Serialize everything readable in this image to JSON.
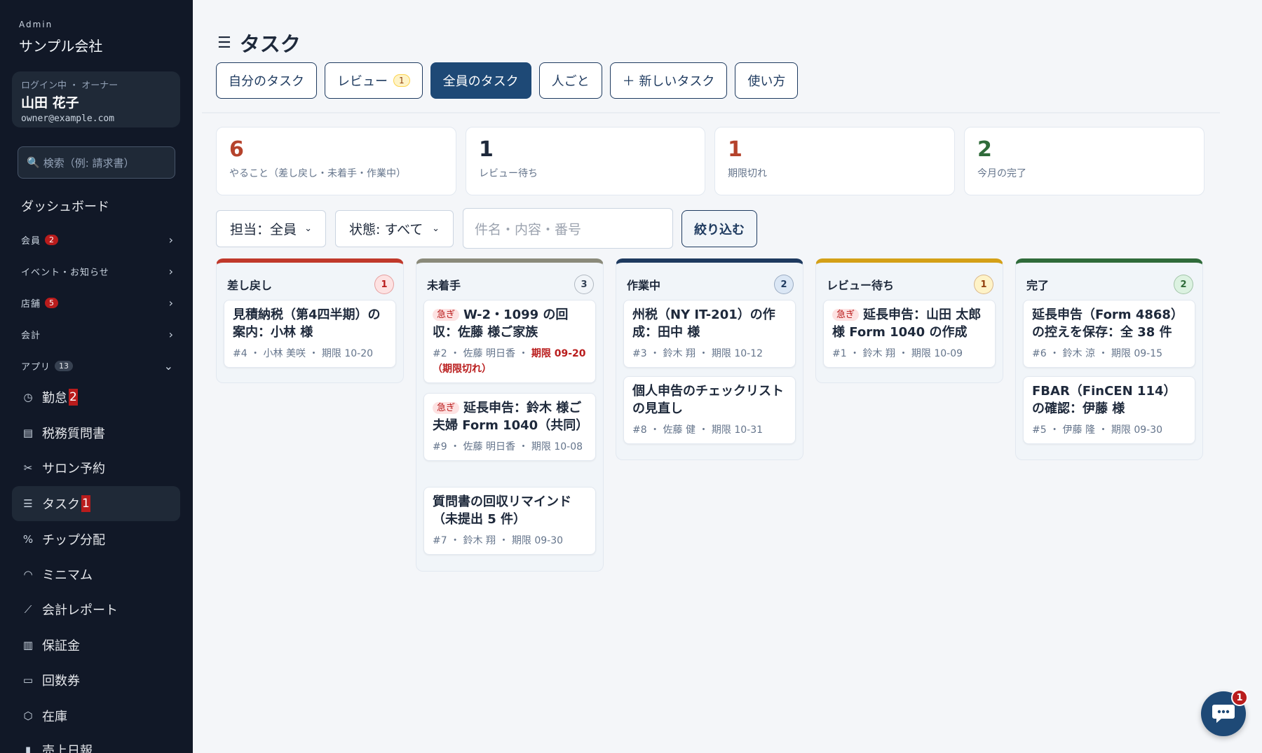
{
  "sidebar": {
    "brand_small": "Admin",
    "brand_name": "サンプル会社",
    "user": {
      "role": "ログイン中 ・ オーナー",
      "name": "山田 花子",
      "email": "owner@example.com"
    },
    "search_placeholder": "検索（例: 請求書）",
    "dashboard": "ダッシュボード",
    "groups": [
      {
        "label": "会員",
        "count": "2"
      },
      {
        "label": "イベント・お知らせ"
      },
      {
        "label": "店舗",
        "count": "5"
      },
      {
        "label": "会計"
      },
      {
        "label": "アプリ",
        "count": "13"
      }
    ],
    "items": [
      {
        "label": "勤怠",
        "badge": "2",
        "icon": "clock-icon"
      },
      {
        "label": "税務質問書",
        "icon": "document-icon"
      },
      {
        "label": "サロン予約",
        "icon": "scissors-icon"
      },
      {
        "label": "タスク",
        "badge": "1",
        "icon": "checklist-icon"
      },
      {
        "label": "チップ分配",
        "icon": "percent-icon"
      },
      {
        "label": "ミニマム",
        "icon": "gauge-icon"
      },
      {
        "label": "会計レポート",
        "icon": "chart-icon"
      },
      {
        "label": "保証金",
        "icon": "receipt-icon"
      },
      {
        "label": "回数券",
        "icon": "ticket-icon"
      },
      {
        "label": "在庫",
        "icon": "box-icon"
      },
      {
        "label": "売上日報",
        "icon": "bar-chart-icon"
      }
    ]
  },
  "page": {
    "title": "タスク"
  },
  "tabs": [
    {
      "label": "自分のタスク"
    },
    {
      "label": "レビュー",
      "pill": "1"
    },
    {
      "label": "全員のタスク"
    },
    {
      "label": "人ごと"
    },
    {
      "label": "＋ 新しいタスク"
    },
    {
      "label": "使い方"
    }
  ],
  "stats": [
    {
      "value": "6",
      "label": "やること（差し戻し・未着手・作業中）",
      "color": "#b5432c"
    },
    {
      "value": "1",
      "label": "レビュー待ち",
      "color": "#1e293b"
    },
    {
      "value": "1",
      "label": "期限切れ",
      "color": "#b5432c"
    },
    {
      "value": "2",
      "label": "今月の完了",
      "color": "#2f6b3a"
    }
  ],
  "filters": {
    "assignee": "担当：全員",
    "status": "状態: すべて",
    "query_placeholder": "件名・内容・番号",
    "apply": "絞り込む"
  },
  "columns": [
    {
      "title": "差し戻し",
      "count": "1",
      "color": "#c0392b",
      "count_bg": "#fde2e2",
      "count_fg": "#b91c1c",
      "cards": [
        {
          "title": "見積納税（第4四半期）の案内：小林 様",
          "meta": "#4 ・ 小林 美咲 ・ 期限 10-20"
        }
      ]
    },
    {
      "title": "未着手",
      "count": "3",
      "color": "#8a8a7a",
      "count_bg": "#f1f5f9",
      "count_fg": "#334155",
      "cards": [
        {
          "urgent": "急ぎ",
          "title": "W-2・1099 の回収：佐藤 様ご家族",
          "meta": "#2 ・ 佐藤 明日香 ・ ",
          "overdue": "期限 09-20（期限切れ）"
        },
        {
          "urgent": "急ぎ",
          "title": "延長申告：鈴木 様ご夫婦 Form 1040（共同）",
          "meta": "#9 ・ 佐藤 明日香 ・ 期限 10-08"
        },
        {
          "title": "質問書の回収リマインド（未提出 5 件）",
          "meta": "#7 ・ 鈴木 翔 ・ 期限 09-30"
        }
      ]
    },
    {
      "title": "作業中",
      "count": "2",
      "color": "#1e3a5f",
      "count_bg": "#dbe7f5",
      "count_fg": "#1e3a5f",
      "cards": [
        {
          "title": "州税（NY IT-201）の作成：田中 様",
          "meta": "#3 ・ 鈴木 翔 ・ 期限 10-12"
        },
        {
          "title": "個人申告のチェックリストの見直し",
          "meta": "#8 ・ 佐藤 健 ・ 期限 10-31"
        }
      ]
    },
    {
      "title": "レビュー待ち",
      "count": "1",
      "color": "#d4a017",
      "count_bg": "#fef3c7",
      "count_fg": "#92400e",
      "cards": [
        {
          "urgent": "急ぎ",
          "title": "延長申告：山田 太郎 様 Form 1040 の作成",
          "meta": "#1 ・ 鈴木 翔 ・ 期限 10-09"
        }
      ]
    },
    {
      "title": "完了",
      "count": "2",
      "color": "#2f6b3a",
      "count_bg": "#dcf2e1",
      "count_fg": "#2f6b3a",
      "cards": [
        {
          "title": "延長申告（Form 4868）の控えを保存：全 38 件",
          "meta": "#6 ・ 鈴木 涼 ・ 期限 09-15"
        },
        {
          "title": "FBAR（FinCEN 114）の確認：伊藤 様",
          "meta": "#5 ・ 伊藤 隆 ・ 期限 09-30"
        }
      ]
    }
  ],
  "chat": {
    "badge": "1"
  }
}
